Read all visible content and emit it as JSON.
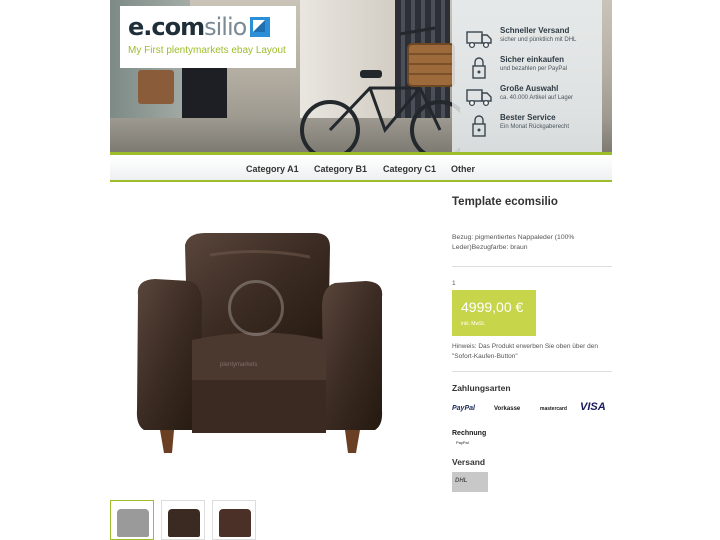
{
  "header": {
    "logo_dark": "e.com",
    "logo_light": "silio",
    "logo_subtitle": "My First plentymarkets ebay Layout",
    "features": [
      {
        "title": "Schneller Versand",
        "subtitle": "sicher und pünktlich mit DHL",
        "icon": "truck-icon"
      },
      {
        "title": "Sicher einkaufen",
        "subtitle": "und bezahlen per PayPal",
        "icon": "lock-icon"
      },
      {
        "title": "Große Auswahl",
        "subtitle": "ca. 40.000 Artikel auf Lager",
        "icon": "truck-icon"
      },
      {
        "title": "Bester Service",
        "subtitle": "Ein Monat Rückgaberecht",
        "icon": "lock-icon"
      }
    ]
  },
  "nav": {
    "items": [
      "Category A1",
      "Category B1",
      "Category C1",
      "Other"
    ]
  },
  "product": {
    "title": "Template ecomsilio",
    "description": "Bezug: pigmentiertes Nappaleder (100% Leder)Bezugfarbe: braun",
    "quantity": "1",
    "price": "4999,00 €",
    "vat_note": "inkl. MwSt.",
    "hint": "Hinweis: Das Produkt erwerben Sie oben über den \"Sofort-Kaufen-Button\"",
    "watermark": "plentymarkets",
    "thumbnails": 3
  },
  "payment": {
    "title": "Zahlungsarten",
    "methods": [
      "PayPal",
      "Vorkasse",
      "mastercard",
      "VISA",
      "Rechnung"
    ],
    "sublabel": "PayPal"
  },
  "shipping": {
    "title": "Versand",
    "carrier": "DHL"
  },
  "colors": {
    "accent": "#9dbd2a",
    "price_bg": "#c7d54a",
    "chair": "#3a2a22"
  }
}
